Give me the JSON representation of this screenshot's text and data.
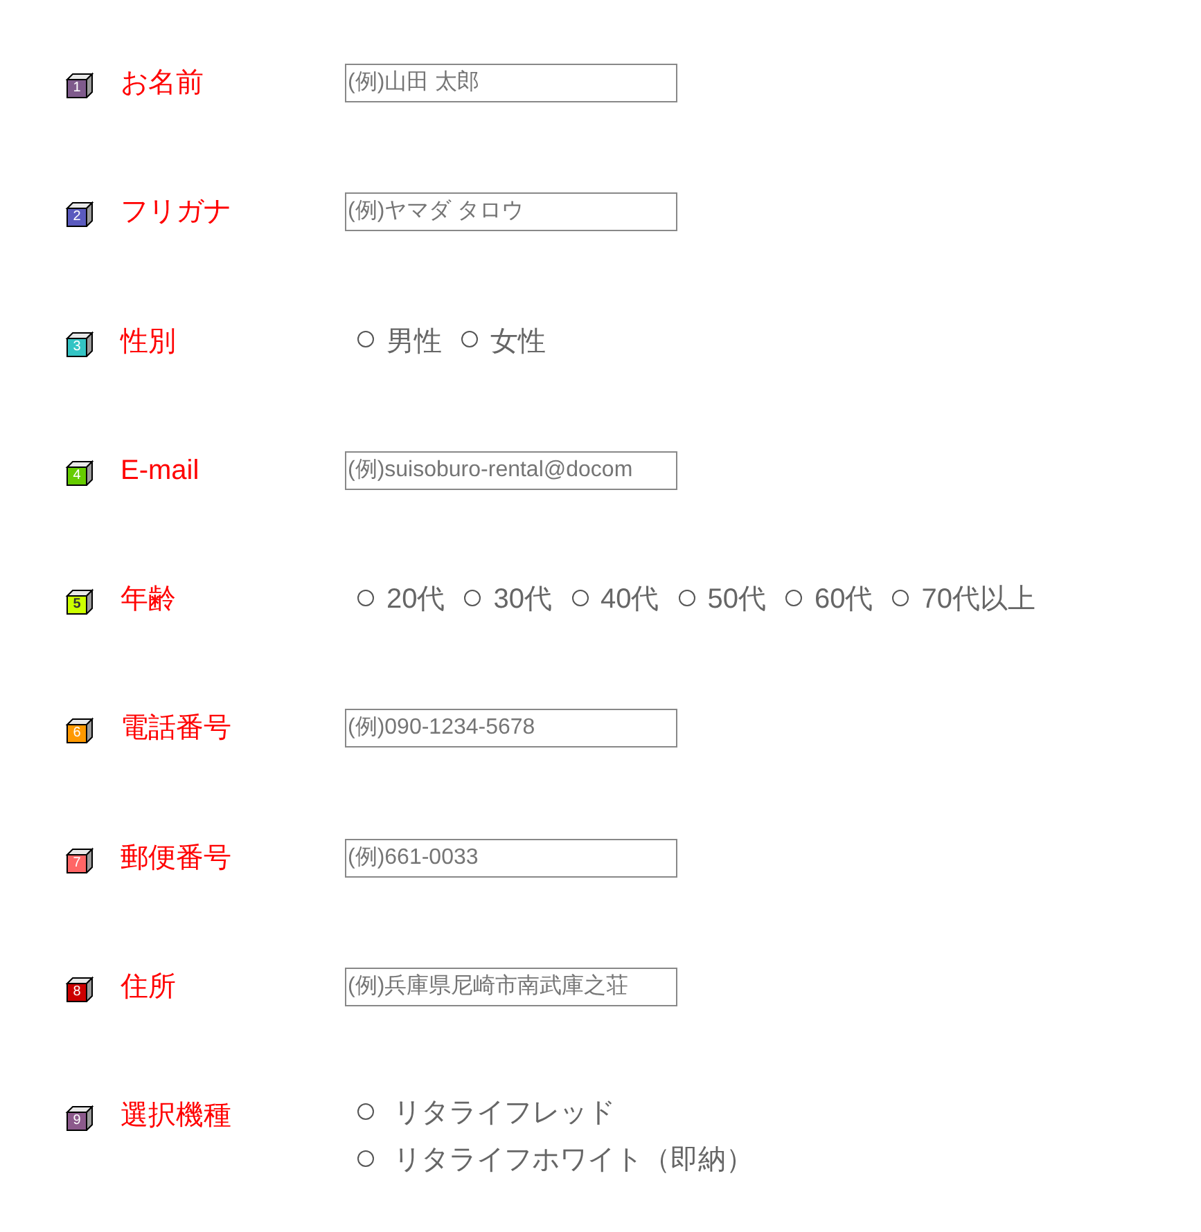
{
  "fields": [
    {
      "kind": "text",
      "number": "1",
      "color": "#7f5a8c",
      "label": "お名前",
      "placeholder": "(例)山田 太郎"
    },
    {
      "kind": "text",
      "number": "2",
      "color": "#5a5abe",
      "label": "フリガナ",
      "placeholder": "(例)ヤマダ タロウ"
    },
    {
      "kind": "radio",
      "number": "3",
      "color": "#33c4c4",
      "label": "性別",
      "options": [
        {
          "label": "男性",
          "selected": false
        },
        {
          "label": "女性",
          "selected": false
        }
      ]
    },
    {
      "kind": "text",
      "number": "4",
      "color": "#66cc00",
      "label": "E-mail",
      "placeholder": "(例)suisoburo-rental@docom"
    },
    {
      "kind": "radio",
      "number": "5",
      "color": "#ccff00",
      "label": "年齢",
      "options": [
        {
          "label": "20代",
          "selected": false
        },
        {
          "label": "30代",
          "selected": false
        },
        {
          "label": "40代",
          "selected": false
        },
        {
          "label": "50代",
          "selected": false
        },
        {
          "label": "60代",
          "selected": false
        },
        {
          "label": "70代以上",
          "selected": false
        }
      ]
    },
    {
      "kind": "text",
      "number": "6",
      "color": "#ff9900",
      "label": "電話番号",
      "placeholder": "(例)090-1234-5678"
    },
    {
      "kind": "text",
      "number": "7",
      "color": "#ff6666",
      "label": "郵便番号",
      "placeholder": "(例)661-0033"
    },
    {
      "kind": "text",
      "number": "8",
      "color": "#cc0000",
      "label": "住所",
      "placeholder": "(例)兵庫県尼崎市南武庫之荘"
    },
    {
      "kind": "radio-stack",
      "number": "9",
      "color": "#8c5a8c",
      "label": "選択機種",
      "options": [
        {
          "label": "リタライフレッド",
          "selected": false
        },
        {
          "label": "リタライフホワイト（即納）",
          "selected": false
        }
      ]
    }
  ]
}
